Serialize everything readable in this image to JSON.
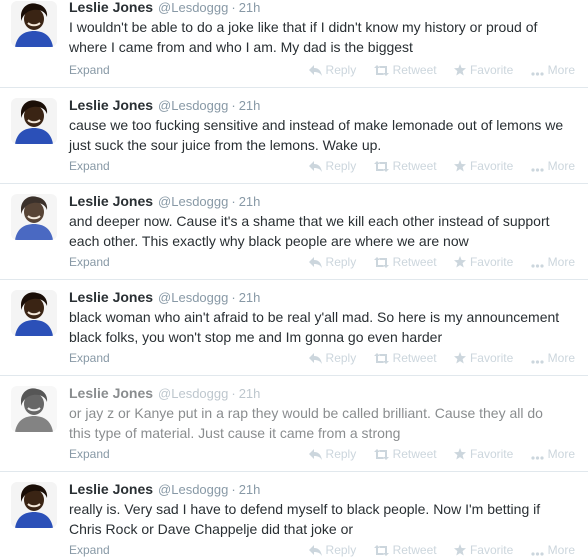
{
  "tweets": [
    {
      "name": "Leslie Jones",
      "handle": "@Lesdoggg",
      "separator": "·",
      "time": "21h",
      "lines": [
        "I wouldn't be able to do a joke like that if I didn't know my history or proud of",
        "where I came from and who I am.  My dad is the biggest"
      ],
      "expand": "Expand"
    },
    {
      "name": "Leslie Jones",
      "handle": "@Lesdoggg",
      "separator": "·",
      "time": "21h",
      "lines": [
        "cause we too fucking sensitive and instead of make lemonade out of lemons we",
        "just suck the sour juice from the lemons. Wake up."
      ],
      "expand": "Expand"
    },
    {
      "name": "Leslie Jones",
      "handle": "@Lesdoggg",
      "separator": "·",
      "time": "21h",
      "lines": [
        "and deeper now. Cause it's a shame that we kill each other instead of support",
        "each other. This exactly why black people are where we are now"
      ],
      "expand": "Expand"
    },
    {
      "name": "Leslie Jones",
      "handle": "@Lesdoggg",
      "separator": "·",
      "time": "21h",
      "lines": [
        "black woman who ain't afraid to be real y'all mad. So here is my announcement",
        "black folks, you won't stop me and Im gonna go even harder"
      ],
      "expand": "Expand"
    },
    {
      "name": "Leslie Jones",
      "handle": "@Lesdoggg",
      "separator": "·",
      "time": "21h",
      "lines": [
        "or jay z or Kanye put in a rap they would be called brilliant. Cause they all do",
        "this type of material. Just cause it came from a strong"
      ],
      "expand": "Expand"
    },
    {
      "name": "Leslie Jones",
      "handle": "@Lesdoggg",
      "separator": "·",
      "time": "21h",
      "lines": [
        "really is. Very sad I have to defend myself to black people. Now I'm betting if",
        "Chris Rock or Dave Chappelje did that joke or"
      ],
      "expand": "Expand"
    }
  ],
  "actions": {
    "reply": "Reply",
    "retweet": "Retweet",
    "favorite": "Favorite",
    "more": "More"
  },
  "colors": {
    "name": "#292f33",
    "meta": "#8899a6",
    "action": "#ccd6dd",
    "divider": "#e1e8ed",
    "avatar_shirt": "#2b50b8",
    "avatar_skin": "#3a2414"
  }
}
